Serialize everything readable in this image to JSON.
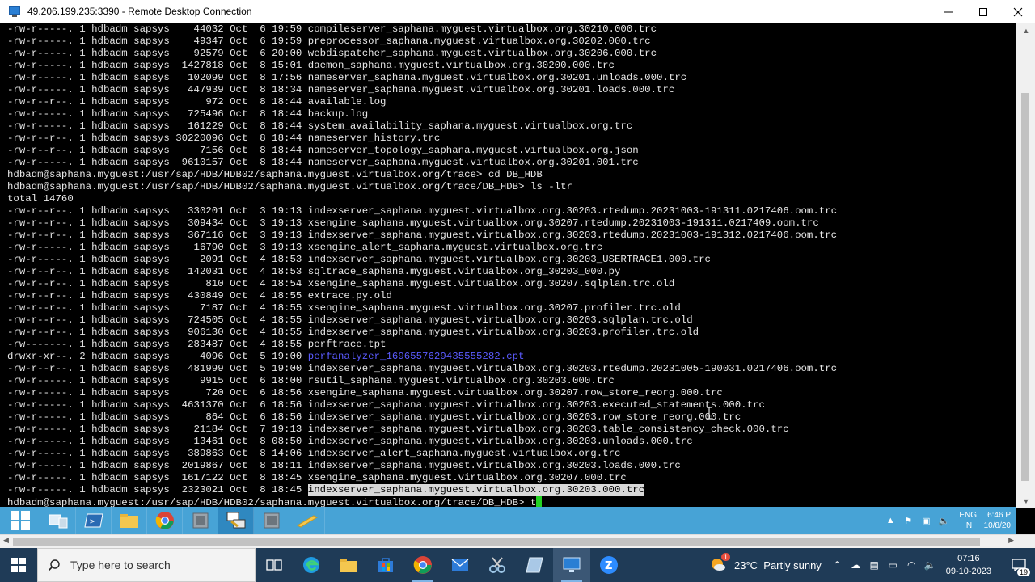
{
  "window": {
    "title": "49.206.199.235:3390 - Remote Desktop Connection"
  },
  "terminal": {
    "lines": [
      {
        "text": "-rw-r-----. 1 hdbadm sapsys    44032 Oct  6 19:59 compileserver_saphana.myguest.virtualbox.org.30210.000.trc"
      },
      {
        "text": "-rw-r-----. 1 hdbadm sapsys    49347 Oct  6 19:59 preprocessor_saphana.myguest.virtualbox.org.30202.000.trc"
      },
      {
        "text": "-rw-r-----. 1 hdbadm sapsys    92579 Oct  6 20:00 webdispatcher_saphana.myguest.virtualbox.org.30206.000.trc"
      },
      {
        "text": "-rw-r-----. 1 hdbadm sapsys  1427818 Oct  8 15:01 daemon_saphana.myguest.virtualbox.org.30200.000.trc"
      },
      {
        "text": "-rw-r-----. 1 hdbadm sapsys   102099 Oct  8 17:56 nameserver_saphana.myguest.virtualbox.org.30201.unloads.000.trc"
      },
      {
        "text": "-rw-r-----. 1 hdbadm sapsys   447939 Oct  8 18:34 nameserver_saphana.myguest.virtualbox.org.30201.loads.000.trc"
      },
      {
        "text": "-rw-r--r--. 1 hdbadm sapsys      972 Oct  8 18:44 available.log"
      },
      {
        "text": "-rw-r-----. 1 hdbadm sapsys   725496 Oct  8 18:44 backup.log"
      },
      {
        "text": "-rw-r-----. 1 hdbadm sapsys   161229 Oct  8 18:44 system_availability_saphana.myguest.virtualbox.org.trc"
      },
      {
        "text": "-rw-r--r--. 1 hdbadm sapsys 30220096 Oct  8 18:44 nameserver_history.trc"
      },
      {
        "text": "-rw-r--r--. 1 hdbadm sapsys     7156 Oct  8 18:44 nameserver_topology_saphana.myguest.virtualbox.org.json"
      },
      {
        "text": "-rw-r-----. 1 hdbadm sapsys  9610157 Oct  8 18:44 nameserver_saphana.myguest.virtualbox.org.30201.001.trc"
      },
      {
        "text": "hdbadm@saphana.myguest:/usr/sap/HDB/HDB02/saphana.myguest.virtualbox.org/trace> cd DB_HDB"
      },
      {
        "text": "hdbadm@saphana.myguest:/usr/sap/HDB/HDB02/saphana.myguest.virtualbox.org/trace/DB_HDB> ls -ltr"
      },
      {
        "text": "total 14760"
      },
      {
        "text": "-rw-r--r--. 1 hdbadm sapsys   330201 Oct  3 19:13 indexserver_saphana.myguest.virtualbox.org.30203.rtedump.20231003-191311.0217406.oom.trc"
      },
      {
        "text": "-rw-r--r--. 1 hdbadm sapsys   309434 Oct  3 19:13 xsengine_saphana.myguest.virtualbox.org.30207.rtedump.20231003-191311.0217409.oom.trc"
      },
      {
        "text": "-rw-r--r--. 1 hdbadm sapsys   367116 Oct  3 19:13 indexserver_saphana.myguest.virtualbox.org.30203.rtedump.20231003-191312.0217406.oom.trc"
      },
      {
        "text": "-rw-r-----. 1 hdbadm sapsys    16790 Oct  3 19:13 xsengine_alert_saphana.myguest.virtualbox.org.trc"
      },
      {
        "text": "-rw-r-----. 1 hdbadm sapsys     2091 Oct  4 18:53 indexserver_saphana.myguest.virtualbox.org.30203_USERTRACE1.000.trc"
      },
      {
        "text": "-rw-r--r--. 1 hdbadm sapsys   142031 Oct  4 18:53 sqltrace_saphana.myguest.virtualbox.org_30203_000.py"
      },
      {
        "text": "-rw-r--r--. 1 hdbadm sapsys      810 Oct  4 18:54 xsengine_saphana.myguest.virtualbox.org.30207.sqlplan.trc.old"
      },
      {
        "text": "-rw-r--r--. 1 hdbadm sapsys   430849 Oct  4 18:55 extrace.py.old"
      },
      {
        "text": "-rw-r--r--. 1 hdbadm sapsys     7187 Oct  4 18:55 xsengine_saphana.myguest.virtualbox.org.30207.profiler.trc.old"
      },
      {
        "text": "-rw-r--r--. 1 hdbadm sapsys   724505 Oct  4 18:55 indexserver_saphana.myguest.virtualbox.org.30203.sqlplan.trc.old"
      },
      {
        "text": "-rw-r--r--. 1 hdbadm sapsys   906130 Oct  4 18:55 indexserver_saphana.myguest.virtualbox.org.30203.profiler.trc.old"
      },
      {
        "text": "-rw-------. 1 hdbadm sapsys   283487 Oct  4 18:55 perftrace.tpt"
      },
      {
        "text": "drwxr-xr--. 2 hdbadm sapsys     4096 Oct  5 19:00 ",
        "dir": "perfanalyzer_1696557629435555282.cpt"
      },
      {
        "text": "-rw-r--r--. 1 hdbadm sapsys   481999 Oct  5 19:00 indexserver_saphana.myguest.virtualbox.org.30203.rtedump.20231005-190031.0217406.oom.trc"
      },
      {
        "text": "-rw-r-----. 1 hdbadm sapsys     9915 Oct  6 18:00 rsutil_saphana.myguest.virtualbox.org.30203.000.trc"
      },
      {
        "text": "-rw-r-----. 1 hdbadm sapsys      720 Oct  6 18:56 xsengine_saphana.myguest.virtualbox.org.30207.row_store_reorg.000.trc"
      },
      {
        "text": "-rw-r-----. 1 hdbadm sapsys  4631370 Oct  6 18:56 indexserver_saphana.myguest.virtualbox.org.30203.executed_statements.000.trc"
      },
      {
        "text": "-rw-r-----. 1 hdbadm sapsys      864 Oct  6 18:56 indexserver_saphana.myguest.virtualbox.org.30203.row_store_reorg.000.trc"
      },
      {
        "text": "-rw-r-----. 1 hdbadm sapsys    21184 Oct  7 19:13 indexserver_saphana.myguest.virtualbox.org.30203.table_consistency_check.000.trc"
      },
      {
        "text": "-rw-r-----. 1 hdbadm sapsys    13461 Oct  8 08:50 indexserver_saphana.myguest.virtualbox.org.30203.unloads.000.trc"
      },
      {
        "text": "-rw-r-----. 1 hdbadm sapsys   389863 Oct  8 14:06 indexserver_alert_saphana.myguest.virtualbox.org.trc"
      },
      {
        "text": "-rw-r-----. 1 hdbadm sapsys  2019867 Oct  8 18:11 indexserver_saphana.myguest.virtualbox.org.30203.loads.000.trc"
      },
      {
        "text": "-rw-r-----. 1 hdbadm sapsys  1617122 Oct  8 18:45 xsengine_saphana.myguest.virtualbox.org.30207.000.trc"
      },
      {
        "text": "-rw-r-----. 1 hdbadm sapsys  2323021 Oct  8 18:45 ",
        "sel": "indexserver_saphana.myguest.virtualbox.org.30203.000.trc"
      },
      {
        "text": "hdbadm@saphana.myguest:/usr/sap/HDB/HDB02/saphana.myguest.virtualbox.org/trace/DB_HDB> t",
        "cursor": true
      }
    ]
  },
  "remote_taskbar": {
    "apps": [
      {
        "name": "server-manager-icon"
      },
      {
        "name": "powershell-icon"
      },
      {
        "name": "file-explorer-icon"
      },
      {
        "name": "chrome-icon"
      },
      {
        "name": "app-window-icon"
      },
      {
        "name": "putty-icon",
        "active": true
      },
      {
        "name": "app-window-icon-2"
      },
      {
        "name": "pencil-app-icon"
      }
    ],
    "lang_top": "ENG",
    "lang_bottom": "IN",
    "time": "6:46 P",
    "date": "10/8/20"
  },
  "local_taskbar": {
    "search_placeholder": "Type here to search",
    "weather": "23°C  Partly sunny",
    "weather_badge": "1",
    "time": "07:16",
    "date": "09-10-2023",
    "notification_count": "19"
  },
  "colors": {
    "terminal_bg": "#000000",
    "terminal_fg": "#e6e6e6",
    "dir_color": "#5b5bff",
    "cursor_color": "#23d223",
    "remote_taskbar": "#47a3d6",
    "local_taskbar": "#1f3b57"
  }
}
